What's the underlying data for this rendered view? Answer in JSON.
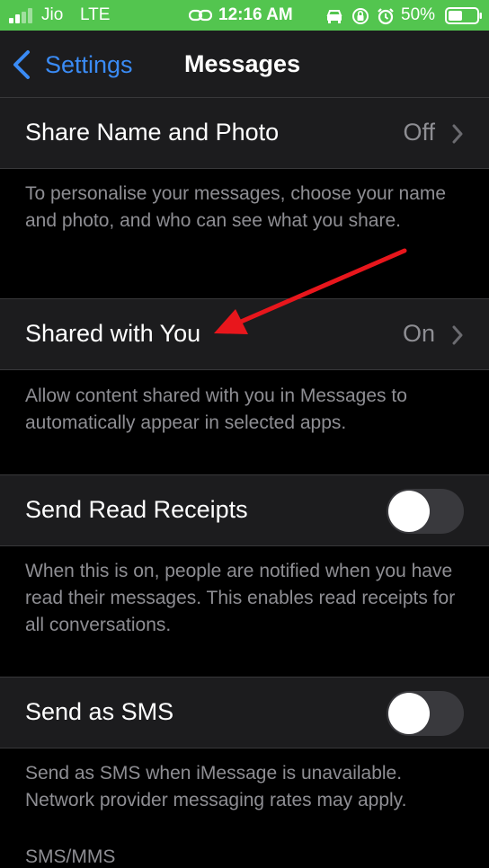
{
  "status_bar": {
    "carrier": "Jio",
    "network": "LTE",
    "time": "12:16 AM",
    "battery": "50%",
    "icons": [
      "signal-icon",
      "hotspot-icon",
      "car-icon",
      "orientation-lock-icon",
      "alarm-icon",
      "battery-icon"
    ]
  },
  "nav": {
    "back_label": "Settings",
    "title": "Messages"
  },
  "settings": {
    "share_name_photo": {
      "label": "Share Name and Photo",
      "value": "Off",
      "footer": "To personalise your messages, choose your name and photo, and who can see what you share."
    },
    "shared_with_you": {
      "label": "Shared with You",
      "value": "On",
      "footer": "Allow content shared with you in Messages to automatically appear in selected apps."
    },
    "send_read_receipts": {
      "label": "Send Read Receipts",
      "toggle_on": false,
      "footer": "When this is on, people are notified when you have read their messages. This enables read receipts for all conversations."
    },
    "send_as_sms": {
      "label": "Send as SMS",
      "toggle_on": false,
      "footer": "Send as SMS when iMessage is unavailable. Network provider messaging rates may apply."
    },
    "sms_mms_header": "SMS/MMS"
  },
  "colors": {
    "status_bar_bg": "#53c54f",
    "accent": "#3a8bf5",
    "annotation": "#e8161c",
    "cell_bg": "#1c1c1e",
    "secondary_text": "#8e8e93"
  }
}
